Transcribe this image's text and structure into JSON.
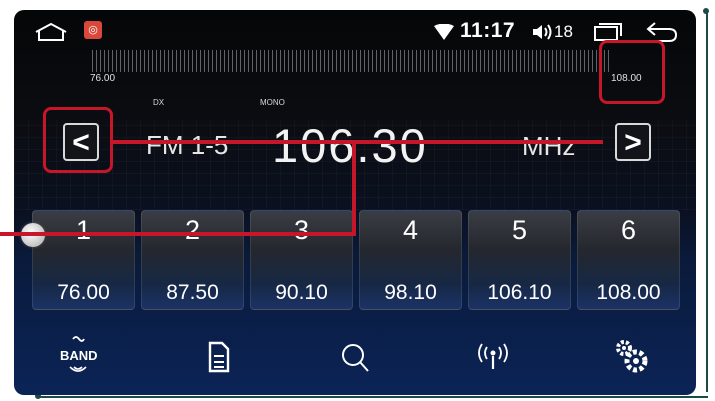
{
  "status_bar": {
    "time": "11:17",
    "volume": "18"
  },
  "tuner": {
    "scale_min": "76.00",
    "scale_max": "108.00",
    "dx_label": "DX",
    "mono_label": "MONO",
    "band": "FM 1-5",
    "frequency": "106.30",
    "unit": "MHz",
    "prev_label": "<",
    "next_label": ">"
  },
  "presets": [
    {
      "number": "1",
      "frequency": "76.00"
    },
    {
      "number": "2",
      "frequency": "87.50"
    },
    {
      "number": "3",
      "frequency": "90.10"
    },
    {
      "number": "4",
      "frequency": "98.10"
    },
    {
      "number": "5",
      "frequency": "106.10"
    },
    {
      "number": "6",
      "frequency": "108.00"
    }
  ],
  "bottom_bar": {
    "band_label": "BAND"
  },
  "icons": [
    "home-icon",
    "radio-app-icon",
    "wifi-icon",
    "volume-icon",
    "recents-icon",
    "back-icon",
    "list-icon",
    "search-icon",
    "antenna-icon",
    "settings-icon"
  ],
  "colors": {
    "callout_red": "#c5162a",
    "frame_teal": "#1c4a47"
  }
}
